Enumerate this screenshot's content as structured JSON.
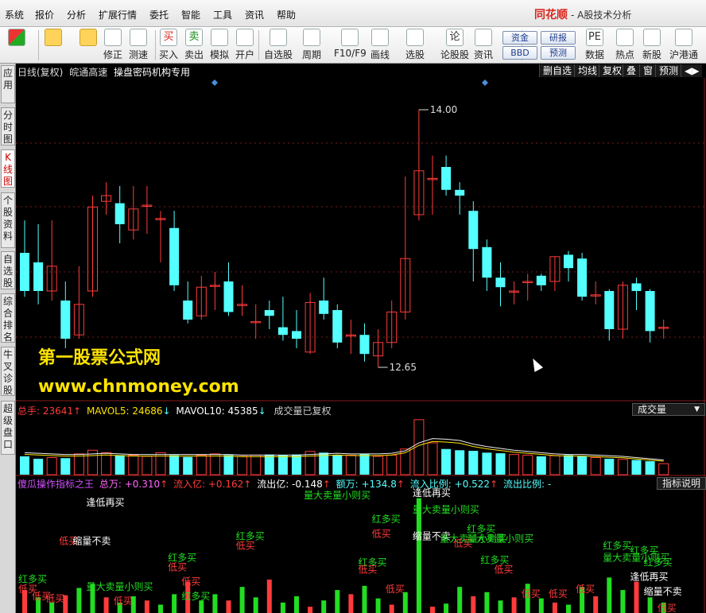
{
  "menu": [
    "系统",
    "报价",
    "分析",
    "扩展行情",
    "委托",
    "智能",
    "工具",
    "资讯",
    "帮助"
  ],
  "brand": {
    "logo": "同花顺",
    "subtitle": "- A股技术分析"
  },
  "toolbar": [
    {
      "icon": "panel-icon",
      "label": ""
    },
    {
      "icon": "back-arrow-icon",
      "label": ""
    },
    {
      "icon": "updown-arrow-icon",
      "label": ""
    },
    {
      "icon": "correct-icon",
      "label": "修正"
    },
    {
      "icon": "speed-icon",
      "label": "测速"
    },
    {
      "icon": "buy-icon",
      "glyph": "买",
      "label": "买入"
    },
    {
      "icon": "sell-icon",
      "glyph": "卖",
      "label": "卖出"
    },
    {
      "icon": "simulate-icon",
      "label": "模拟"
    },
    {
      "icon": "lock-icon",
      "label": "开户"
    },
    {
      "icon": "watchlist-icon",
      "label": "自选股"
    },
    {
      "icon": "period-icon",
      "label": "周期"
    },
    {
      "icon": "f10-icon",
      "label": "F10/F9"
    },
    {
      "icon": "draw-icon",
      "label": "画线"
    },
    {
      "icon": "select-stock-icon",
      "label": "选股"
    },
    {
      "icon": "forum-icon",
      "glyph": "论",
      "label": "论股股"
    },
    {
      "icon": "news-icon",
      "label": "资讯"
    },
    {
      "icon": "data-icon",
      "glyph": "PE",
      "label": "数据"
    },
    {
      "icon": "hot-icon",
      "label": "热点"
    },
    {
      "icon": "newstock-icon",
      "label": "新股"
    },
    {
      "icon": "hk-icon",
      "label": "沪港通"
    }
  ],
  "pills": {
    "fund": "资金",
    "bbd": "BBD",
    "research": "研报",
    "forecast": "预测"
  },
  "sidebar": [
    "应用",
    "分时图",
    "K线图",
    "个股资料",
    "自选股",
    "综合排名",
    "牛叉诊股",
    "超级盘口"
  ],
  "chart_header": {
    "period": "日线(复权)",
    "stock": "皖通高速",
    "formula": "操盘密码机构专用",
    "right_tabs": [
      "删自选",
      "均线",
      "复权",
      "叠",
      "窗",
      "预测"
    ]
  },
  "watermark": {
    "title": "第一股票公式网",
    "url": "www.chnmoney.com"
  },
  "volume_header": {
    "label": "总手: 23641",
    "ma5": "MAVOL5: 24686",
    "ma10": "MAVOL10: 45385",
    "note": "成交量已复权",
    "selector": "成交量"
  },
  "indicator_header": {
    "name": "傻瓜操作指标之王",
    "total": "总万: +0.310",
    "inflow": "流入亿: +0.162",
    "outflow": "流出亿: -0.148",
    "amount": "额万: +134.8",
    "inratio": "流入比例: +0.522",
    "outratio": "流出比例: -",
    "explain_button": "指标说明"
  },
  "colors": {
    "up": "#ff3b3b",
    "down": "#54ffff",
    "green": "#22dd22",
    "yellow": "#ffe400",
    "bg": "#000000"
  },
  "chart_data": {
    "type": "candlestick",
    "price_labels": {
      "high": "14.00",
      "low": "12.65"
    },
    "ylim": [
      12.55,
      14.1
    ],
    "candles": [
      {
        "o": 13.25,
        "c": 13.05,
        "h": 13.42,
        "l": 13.02
      },
      {
        "o": 13.2,
        "c": 13.05,
        "h": 13.4,
        "l": 12.98
      },
      {
        "o": 13.05,
        "c": 13.18,
        "h": 13.42,
        "l": 13.0
      },
      {
        "o": 13.0,
        "c": 12.8,
        "h": 13.1,
        "l": 12.75
      },
      {
        "o": 12.82,
        "c": 12.98,
        "h": 13.18,
        "l": 12.8
      },
      {
        "o": 13.05,
        "c": 13.49,
        "h": 13.55,
        "l": 13.02
      },
      {
        "o": 13.52,
        "c": 13.55,
        "h": 13.62,
        "l": 13.45
      },
      {
        "o": 13.51,
        "c": 13.4,
        "h": 13.6,
        "l": 13.3
      },
      {
        "o": 13.37,
        "c": 13.48,
        "h": 13.6,
        "l": 13.32
      },
      {
        "o": 13.5,
        "c": 13.5,
        "h": 13.6,
        "l": 13.35
      },
      {
        "o": 13.43,
        "c": 13.43,
        "h": 13.47,
        "l": 13.2
      },
      {
        "o": 13.38,
        "c": 13.08,
        "h": 13.47,
        "l": 13.05
      },
      {
        "o": 13.0,
        "c": 12.9,
        "h": 13.1,
        "l": 12.88
      },
      {
        "o": 12.92,
        "c": 13.07,
        "h": 13.13,
        "l": 12.9
      },
      {
        "o": 13.08,
        "c": 13.08,
        "h": 13.15,
        "l": 12.95
      },
      {
        "o": 13.1,
        "c": 12.94,
        "h": 13.2,
        "l": 12.92
      },
      {
        "o": 12.98,
        "c": 12.98,
        "h": 13.08,
        "l": 12.92
      },
      {
        "o": 12.89,
        "c": 12.89,
        "h": 12.98,
        "l": 12.8
      },
      {
        "o": 12.95,
        "c": 12.92,
        "h": 13.0,
        "l": 12.85
      },
      {
        "o": 12.86,
        "c": 12.82,
        "h": 13.02,
        "l": 12.79
      },
      {
        "o": 12.84,
        "c": 12.8,
        "h": 12.95,
        "l": 12.75
      },
      {
        "o": 12.73,
        "c": 12.99,
        "h": 13.04,
        "l": 12.72
      },
      {
        "o": 13.0,
        "c": 12.93,
        "h": 13.12,
        "l": 12.9
      },
      {
        "o": 12.95,
        "c": 12.78,
        "h": 12.98,
        "l": 12.75
      },
      {
        "o": 12.82,
        "c": 12.82,
        "h": 12.9,
        "l": 12.72
      },
      {
        "o": 12.82,
        "c": 12.72,
        "h": 12.88,
        "l": 12.68
      },
      {
        "o": 12.71,
        "c": 12.78,
        "h": 12.85,
        "l": 12.65
      },
      {
        "o": 12.78,
        "c": 12.94,
        "h": 13.0,
        "l": 12.75
      },
      {
        "o": 12.94,
        "c": 13.22,
        "h": 13.65,
        "l": 12.9
      },
      {
        "o": 13.45,
        "c": 13.68,
        "h": 14.0,
        "l": 13.42
      },
      {
        "o": 13.64,
        "c": 13.64,
        "h": 13.76,
        "l": 13.45
      },
      {
        "o": 13.7,
        "c": 13.58,
        "h": 13.76,
        "l": 13.55
      },
      {
        "o": 13.58,
        "c": 13.55,
        "h": 13.62,
        "l": 13.45
      },
      {
        "o": 13.47,
        "c": 13.27,
        "h": 13.52,
        "l": 13.1
      },
      {
        "o": 13.28,
        "c": 13.12,
        "h": 13.32,
        "l": 13.05
      },
      {
        "o": 13.12,
        "c": 13.07,
        "h": 13.2,
        "l": 12.97
      },
      {
        "o": 13.05,
        "c": 13.05,
        "h": 13.1,
        "l": 12.98
      },
      {
        "o": 13.1,
        "c": 13.1,
        "h": 13.14,
        "l": 13.0
      },
      {
        "o": 13.13,
        "c": 13.08,
        "h": 13.14,
        "l": 13.05
      },
      {
        "o": 13.1,
        "c": 13.23,
        "h": 13.23,
        "l": 13.05
      },
      {
        "o": 13.24,
        "c": 13.17,
        "h": 13.26,
        "l": 13.1
      },
      {
        "o": 13.22,
        "c": 13.02,
        "h": 13.25,
        "l": 13.0
      },
      {
        "o": 13.03,
        "c": 13.03,
        "h": 13.1,
        "l": 12.98
      },
      {
        "o": 13.05,
        "c": 12.85,
        "h": 13.06,
        "l": 12.79
      },
      {
        "o": 12.85,
        "c": 13.08,
        "h": 13.1,
        "l": 12.8
      },
      {
        "o": 13.09,
        "c": 13.05,
        "h": 13.12,
        "l": 12.95
      },
      {
        "o": 13.05,
        "c": 12.84,
        "h": 13.06,
        "l": 12.78
      },
      {
        "o": 12.86,
        "c": 12.86,
        "h": 12.9,
        "l": 12.8
      }
    ],
    "volumes": [
      3.0,
      2.6,
      2.8,
      2.7,
      3.4,
      4.0,
      3.6,
      3.2,
      3.2,
      3.0,
      3.6,
      3.2,
      2.9,
      3.2,
      3.4,
      3.2,
      3.0,
      3.2,
      3.3,
      3.2,
      3.3,
      3.8,
      3.6,
      3.2,
      3.2,
      3.4,
      3.0,
      3.2,
      4.2,
      9.0,
      5.2,
      4.2,
      4.0,
      3.9,
      3.6,
      3.5,
      3.3,
      3.2,
      3.0,
      3.1,
      3.2,
      3.0,
      2.8,
      2.6,
      2.5,
      2.4,
      2.2,
      1.8
    ],
    "volume_ma": [
      3.6,
      3.5,
      3.4,
      3.3,
      3.3,
      3.4,
      3.5,
      3.4,
      3.3,
      3.3,
      3.3,
      3.3,
      3.3,
      3.3,
      3.3,
      3.3,
      3.2,
      3.2,
      3.2,
      3.2,
      3.2,
      3.3,
      3.4,
      3.5,
      3.4,
      3.4,
      3.4,
      3.5,
      3.9,
      5.2,
      5.9,
      5.8,
      5.6,
      5.0,
      4.6,
      4.3,
      4.0,
      3.8,
      3.6,
      3.4,
      3.3,
      3.3,
      3.2,
      3.1,
      3.0,
      2.8,
      2.6,
      2.4
    ],
    "indicator_bars": [
      2.2,
      1.5,
      1.0,
      1.7,
      2.4,
      2.8,
      1.5,
      1.0,
      1.6,
      1.2,
      0.8,
      1.8,
      3.0,
      1.2,
      1.8,
      1.2,
      2.5,
      1.5,
      3.2,
      1.0,
      1.6,
      0.6,
      1.2,
      2.2,
      1.8,
      2.6,
      1.4,
      0.8,
      2.0,
      11.0,
      0.6,
      0.9,
      2.5,
      1.6,
      2.0,
      1.2,
      1.5,
      2.8,
      1.4,
      1.0,
      0.8,
      2.5,
      1.6,
      3.4,
      2.2,
      3.0,
      1.5,
      1.0
    ],
    "indicator_labels": [
      {
        "i": 0,
        "t": "红多买",
        "c": "green",
        "y": 0.28
      },
      {
        "i": 0,
        "t": "低买",
        "c": "red",
        "y": 0.2
      },
      {
        "i": 1,
        "t": "低买",
        "c": "red",
        "y": 0.14
      },
      {
        "i": 2,
        "t": "低买",
        "c": "red",
        "y": 0.12
      },
      {
        "i": 3,
        "t": "低买",
        "c": "red",
        "y": 0.6
      },
      {
        "i": 4,
        "t": "缩量不卖",
        "c": "white",
        "y": 0.6
      },
      {
        "i": 5,
        "t": "量大卖量小则买",
        "c": "green",
        "y": 0.22
      },
      {
        "i": 5,
        "t": "逢低再买",
        "c": "white",
        "y": 0.92
      },
      {
        "i": 7,
        "t": "低买",
        "c": "red",
        "y": 0.1
      },
      {
        "i": 11,
        "t": "红多买",
        "c": "green",
        "y": 0.46
      },
      {
        "i": 11,
        "t": "低买",
        "c": "red",
        "y": 0.38
      },
      {
        "i": 12,
        "t": "低买",
        "c": "red",
        "y": 0.26
      },
      {
        "i": 12,
        "t": "红多买",
        "c": "green",
        "y": 0.14
      },
      {
        "i": 16,
        "t": "红多买",
        "c": "green",
        "y": 0.64
      },
      {
        "i": 16,
        "t": "低买",
        "c": "red",
        "y": 0.56
      },
      {
        "i": 21,
        "t": "量大卖量小则买",
        "c": "green",
        "y": 0.98
      },
      {
        "i": 25,
        "t": "红多买",
        "c": "green",
        "y": 0.42
      },
      {
        "i": 25,
        "t": "低买",
        "c": "red",
        "y": 0.36
      },
      {
        "i": 27,
        "t": "低买",
        "c": "red",
        "y": 0.2
      },
      {
        "i": 26,
        "t": "红多买",
        "c": "green",
        "y": 0.78
      },
      {
        "i": 26,
        "t": "低买",
        "c": "red",
        "y": 0.66
      },
      {
        "i": 29,
        "t": "逢低再买",
        "c": "white",
        "y": 1.0
      },
      {
        "i": 29,
        "t": "量大卖量小则买",
        "c": "green",
        "y": 0.86
      },
      {
        "i": 29,
        "t": "缩量不卖",
        "c": "white",
        "y": 0.64
      },
      {
        "i": 31,
        "t": "量大卖量小则买",
        "c": "green",
        "y": 0.62
      },
      {
        "i": 32,
        "t": "低买",
        "c": "red",
        "y": 0.58
      },
      {
        "i": 33,
        "t": "红多买",
        "c": "green",
        "y": 0.7
      },
      {
        "i": 33,
        "t": "量大卖量小则买",
        "c": "green",
        "y": 0.62
      },
      {
        "i": 34,
        "t": "红多买",
        "c": "green",
        "y": 0.44
      },
      {
        "i": 35,
        "t": "低买",
        "c": "red",
        "y": 0.36
      },
      {
        "i": 37,
        "t": "低买",
        "c": "red",
        "y": 0.16
      },
      {
        "i": 39,
        "t": "低买",
        "c": "red",
        "y": 0.16
      },
      {
        "i": 41,
        "t": "低买",
        "c": "red",
        "y": 0.2
      },
      {
        "i": 43,
        "t": "量大卖量小则买",
        "c": "green",
        "y": 0.46
      },
      {
        "i": 43,
        "t": "红多买",
        "c": "green",
        "y": 0.56
      },
      {
        "i": 45,
        "t": "红多买",
        "c": "green",
        "y": 0.52
      },
      {
        "i": 45,
        "t": "逢低再买",
        "c": "white",
        "y": 0.3
      },
      {
        "i": 46,
        "t": "红多买",
        "c": "green",
        "y": 0.42
      },
      {
        "i": 46,
        "t": "缩量不卖",
        "c": "white",
        "y": 0.18
      },
      {
        "i": 47,
        "t": "低买",
        "c": "red",
        "y": 0.04
      }
    ]
  }
}
